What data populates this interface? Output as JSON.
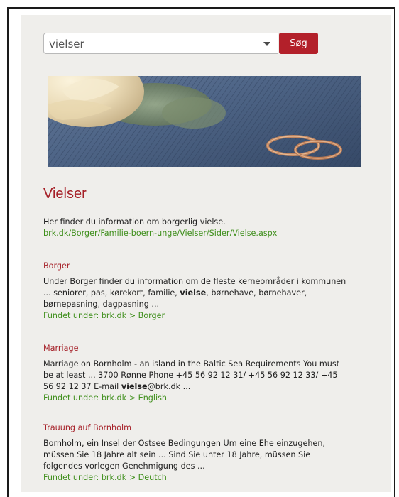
{
  "search": {
    "value": "vielser",
    "button_label": "Søg"
  },
  "page": {
    "title": "Vielser",
    "intro_text": "Her finder du information om borgerlig vielse.",
    "intro_link": "brk.dk/Borger/Familie-boern-unge/Vielser/Sider/Vielse.aspx"
  },
  "results": [
    {
      "title": "Borger",
      "lines": [
        [
          "Under Borger finder du information om de fleste kerneområder i kommunen"
        ],
        [
          "... seniorer, pas, kørekort, familie, ",
          {
            "b": "vielse"
          },
          ", børnehave, børnehaver,"
        ],
        [
          "børnepasning, dagpasning ..."
        ]
      ],
      "found_under": "Fundet under: brk.dk > Borger"
    },
    {
      "title": "Marriage",
      "lines": [
        [
          "Marriage on Bornholm - an island in the Baltic Sea Requirements You must"
        ],
        [
          "be at least ... 3700 Rønne Phone +45 56 92 12 31/ +45 56 92 12 33/ +45"
        ],
        [
          "56 92 12 37 E-mail ",
          {
            "b": "vielse"
          },
          "@brk.dk ..."
        ]
      ],
      "found_under": "Fundet under: brk.dk > English"
    },
    {
      "title": "Trauung auf Bornholm",
      "lines": [
        [
          "Bornholm, ein Insel der Ostsee Bedingungen Um eine Ehe einzugehen,"
        ],
        [
          "müssen Sie 18 Jahre alt sein ... Sind Sie unter 18 Jahre, müssen Sie"
        ],
        [
          "folgendes vorlegen Genehmigung des ..."
        ]
      ],
      "found_under": "Fundet under: brk.dk > Deutch"
    }
  ],
  "colors": {
    "accent": "#b3202a",
    "title": "#a51f27",
    "link": "#3f8f1c",
    "panel": "#efeeeb"
  }
}
